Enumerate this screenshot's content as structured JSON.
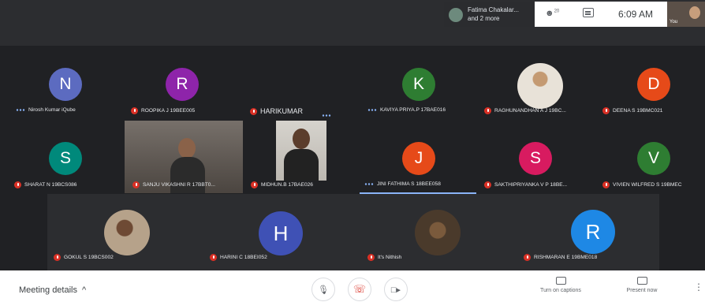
{
  "topbar": {
    "presenter_text": "Fatima Chakalar...",
    "presenter_more": "and 2 more",
    "people_count": "20",
    "time": "6:09 AM",
    "self_label": "You"
  },
  "participants": [
    {
      "name": "Nirosh Kumar iQube",
      "initial": "N",
      "color": "#5c6bc0",
      "indicator": "dots"
    },
    {
      "name": "ROOPIKA J 19BEE005",
      "initial": "R",
      "color": "#8e24aa",
      "indicator": "mic"
    },
    {
      "name": "HARIKUMAR",
      "initial": "",
      "color": "",
      "indicator": "mic"
    },
    {
      "name": "KAVIYA PRIYA.P 17BAE016",
      "initial": "K",
      "color": "#2e7d32",
      "indicator": "dots"
    },
    {
      "name": "RAGHUNANDHAN A J 19BC...",
      "initial": "",
      "color": "",
      "indicator": "mic"
    },
    {
      "name": "DEENA S 19BMC021",
      "initial": "D",
      "color": "#e64a19",
      "indicator": "mic"
    },
    {
      "name": "SHARAT N 19BCS086",
      "initial": "S",
      "color": "#00897b",
      "indicator": "mic"
    },
    {
      "name": "SANJU VIKASHNI R 17BBT0...",
      "initial": "",
      "color": "",
      "indicator": "mic"
    },
    {
      "name": "MIDHUN.B 17BAE026",
      "initial": "",
      "color": "",
      "indicator": "mic"
    },
    {
      "name": "JINI FATHIMA S 18BEE058",
      "initial": "J",
      "color": "#e64a19",
      "indicator": "dots"
    },
    {
      "name": "SAKTHIPRIYANKA V P 18BE...",
      "initial": "S",
      "color": "#d81b60",
      "indicator": "mic"
    },
    {
      "name": "VIVIEN WILFRED S 19BMEC",
      "initial": "V",
      "color": "#2e7d32",
      "indicator": "mic"
    },
    {
      "name": "GOKUL S 19BCS002",
      "initial": "",
      "color": "",
      "indicator": "mic"
    },
    {
      "name": "HARINI C 18BEI052",
      "initial": "H",
      "color": "#3f51b5",
      "indicator": "mic"
    },
    {
      "name": "It's Nithish",
      "initial": "",
      "color": "",
      "indicator": "mic"
    },
    {
      "name": "RISHMARAN E 19BME018",
      "initial": "R",
      "color": "#1e88e5",
      "indicator": "mic"
    }
  ],
  "bottombar": {
    "meeting_details": "Meeting details",
    "captions_label": "Turn on captions",
    "present_label": "Present now"
  }
}
